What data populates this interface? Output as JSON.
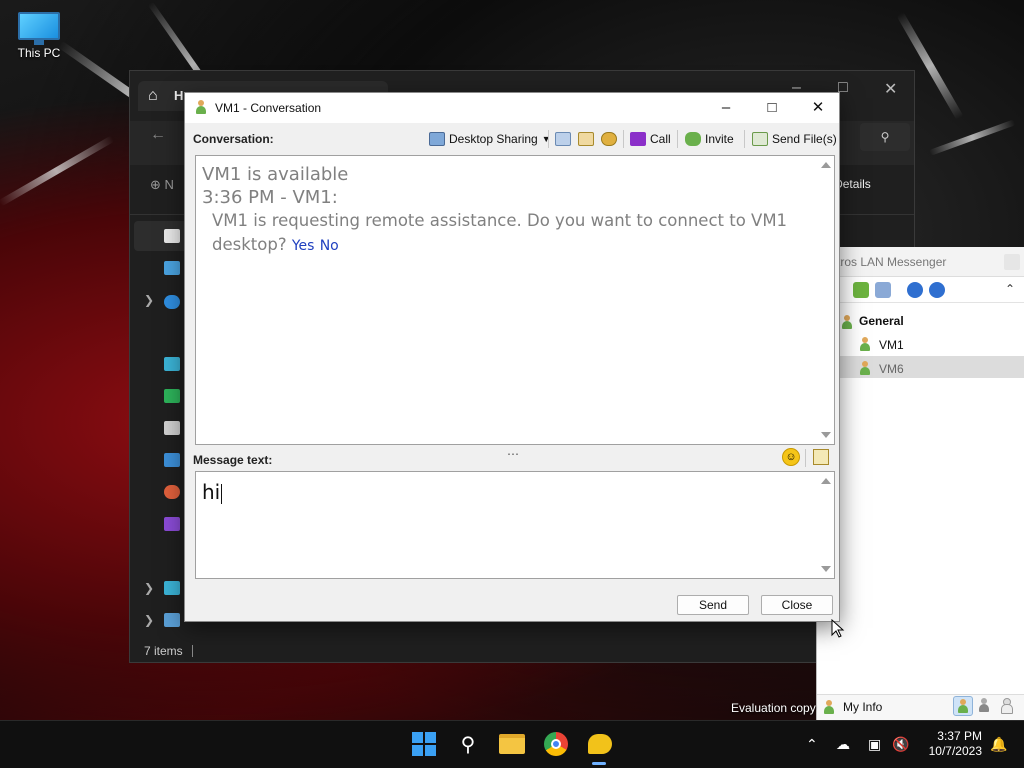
{
  "desktop": {
    "this_pc_label": "This PC",
    "evaluation_text": "Evaluation copy"
  },
  "explorer": {
    "tab_title": "H",
    "new_label": "N",
    "details_label": "Details",
    "status_items": "7 items"
  },
  "lan_messenger": {
    "title": "tros LAN Messenger",
    "group_name": "General",
    "users": [
      "VM1",
      "VM6"
    ],
    "selected_user": "VM6",
    "my_info_label": "My Info"
  },
  "conversation": {
    "window_title": "VM1 - Conversation",
    "conversation_label": "Conversation:",
    "toolbar": {
      "desktop_sharing": "Desktop Sharing",
      "call": "Call",
      "invite": "Invite",
      "send_files": "Send File(s)"
    },
    "history": {
      "status_line": "VM1 is available",
      "time_line": "3:36 PM - VM1:",
      "message_line1": "VM1 is requesting remote assistance. Do you want to connect to VM1",
      "message_line2": "desktop?",
      "yes_link": "Yes",
      "no_link": "No"
    },
    "message_label": "Message text:",
    "message_value": "hi",
    "send_button": "Send",
    "close_button": "Close"
  },
  "taskbar": {
    "time": "3:37 PM",
    "date": "10/7/2023"
  },
  "colors": {
    "link": "#1f3fbf",
    "history_text": "#808080",
    "accent_blue": "#3aa0f3"
  }
}
